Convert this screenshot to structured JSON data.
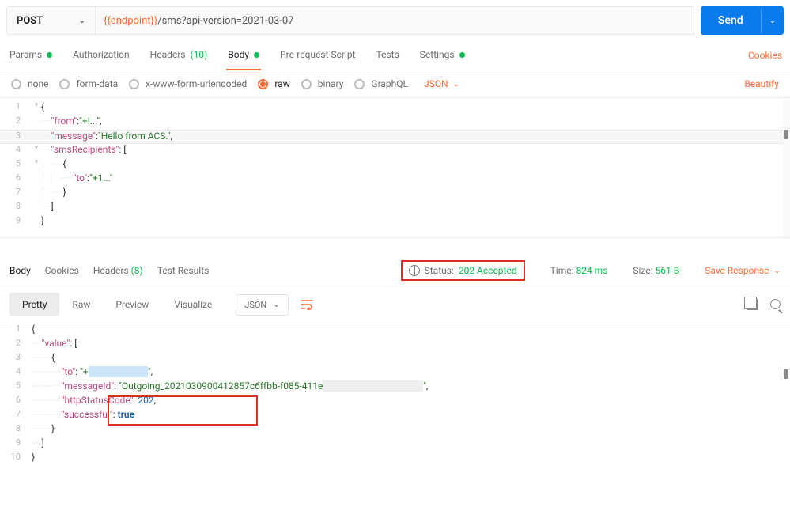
{
  "request": {
    "method": "POST",
    "url_template": "{{endpoint}}",
    "url_path": "/sms?api-version=2021-03-07",
    "send_label": "Send"
  },
  "tabs": {
    "params": "Params",
    "auth": "Authorization",
    "headers": "Headers",
    "headers_count": "(10)",
    "body": "Body",
    "prescript": "Pre-request Script",
    "tests": "Tests",
    "settings": "Settings",
    "cookies": "Cookies"
  },
  "body_types": {
    "none": "none",
    "formdata": "form-data",
    "urlencoded": "x-www-form-urlencoded",
    "raw": "raw",
    "binary": "binary",
    "graphql": "GraphQL",
    "langdd": "JSON",
    "beautify": "Beautify"
  },
  "request_body_lines": [
    {
      "ln": "1",
      "indent": "",
      "text": "{"
    },
    {
      "ln": "2",
      "indent": "    ",
      "key": "\"from\"",
      "sep": ":",
      "val": "\"+!...\"",
      "tail": ","
    },
    {
      "ln": "3",
      "indent": "    ",
      "key": "\"message\"",
      "sep": ":",
      "val": "\"Hello from ACS.\"",
      "tail": ","
    },
    {
      "ln": "4",
      "indent": "    ",
      "key": "\"smsRecipients\"",
      "sep": ": ",
      "valplain": "[",
      "tail": ""
    },
    {
      "ln": "5",
      "indent": "        ",
      "text": "{"
    },
    {
      "ln": "6",
      "indent": "            ",
      "key": "\"to\"",
      "sep": ":",
      "val": "\"+1...\"",
      "tail": ""
    },
    {
      "ln": "7",
      "indent": "        ",
      "text": "}"
    },
    {
      "ln": "8",
      "indent": "    ",
      "text": "]"
    },
    {
      "ln": "9",
      "indent": "",
      "text": "}"
    }
  ],
  "response_tabs": {
    "body": "Body",
    "cookies": "Cookies",
    "headers": "Headers",
    "headers_count": "(8)",
    "tests": "Test Results"
  },
  "response_meta": {
    "status_label": "Status:",
    "status_value": "202 Accepted",
    "time_label": "Time:",
    "time_value": "824 ms",
    "size_label": "Size:",
    "size_value": "561 B",
    "save": "Save Response"
  },
  "viewer": {
    "pretty": "Pretty",
    "raw": "Raw",
    "preview": "Preview",
    "visualize": "Visualize",
    "langdd": "JSON"
  },
  "response_body": {
    "l1": "{",
    "l2_k": "\"value\"",
    "l2_v": "[",
    "l3": "{",
    "l4_k": "\"to\"",
    "l4_v": "\"+",
    "l4_blur": "XXXXXXXXXX",
    "l4_end": "\"",
    "l5_k": "\"messageId\"",
    "l5_v": "\"Outgoing_2021030900412857c6ffbb-f085-411e",
    "l5_blur": "-XXXX-XXXXXXXXXXXX",
    "l5_end": "\"",
    "l6_k": "\"httpStatusCode\"",
    "l6_v": "202",
    "l7_k": "\"successful\"",
    "l7_v": "true",
    "l8": "}",
    "l9": "]",
    "l10": "}"
  }
}
